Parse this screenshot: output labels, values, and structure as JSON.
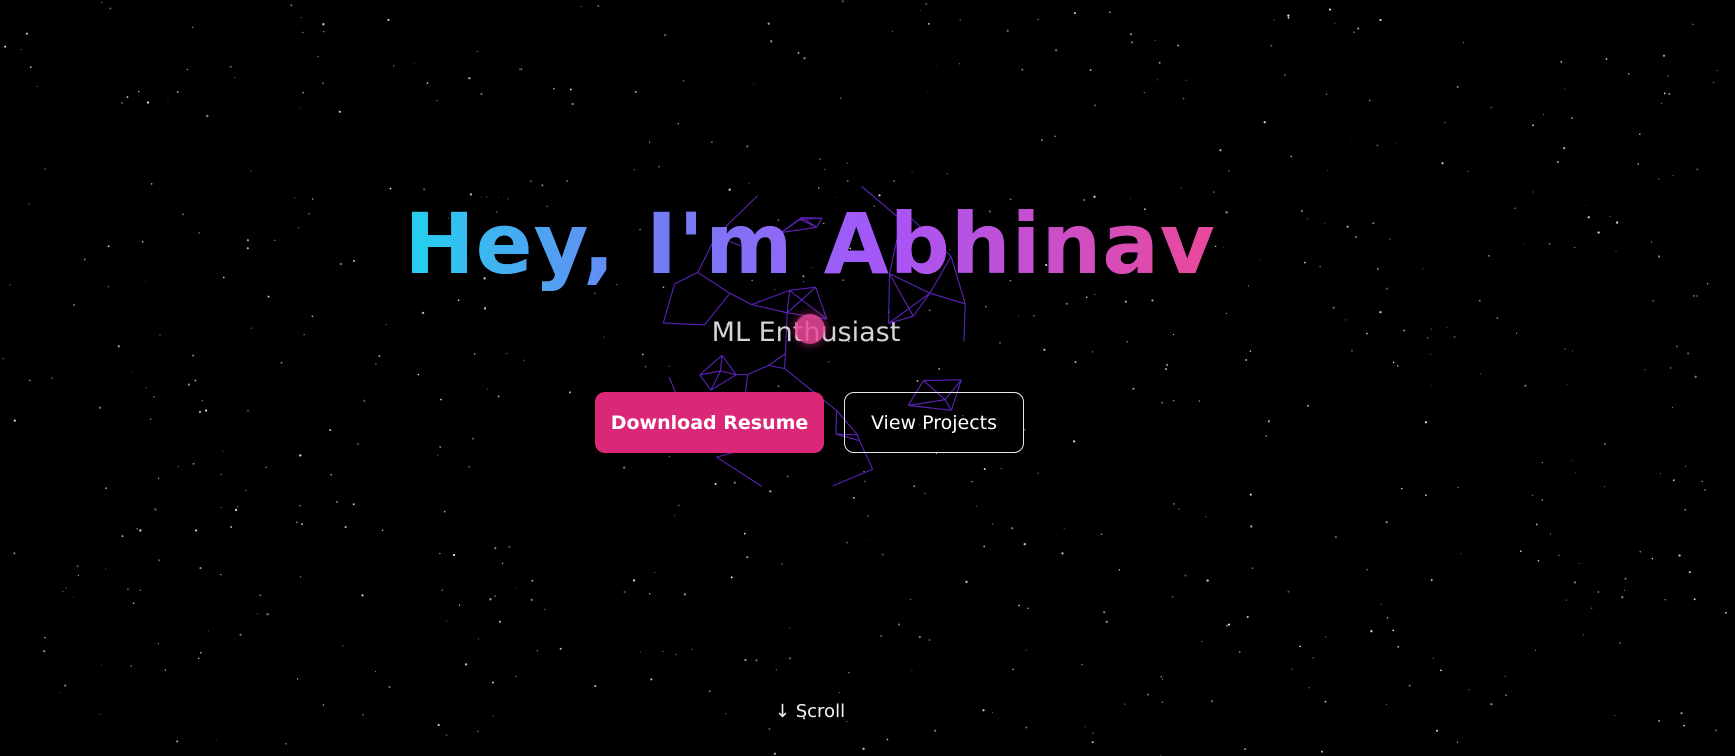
{
  "hero": {
    "title": "Hey, I'm Abhinav",
    "subtitle": "ML Enthusiast"
  },
  "buttons": {
    "download_resume": "Download Resume",
    "view_projects": "View Projects"
  },
  "scroll_hint": "↓ Scroll",
  "colors": {
    "background": "#000000",
    "gradient_start": "#22d3ee",
    "gradient_mid_blue": "#6f7ff5",
    "gradient_mid_purple": "#a855f7",
    "gradient_end": "#ec4899",
    "primary_button": "#db2777",
    "wireframe": "#6d28d9"
  },
  "icons": {
    "wireframe_sphere": "wireframe-globe-icon",
    "cursor": "cursor-dot-icon"
  }
}
